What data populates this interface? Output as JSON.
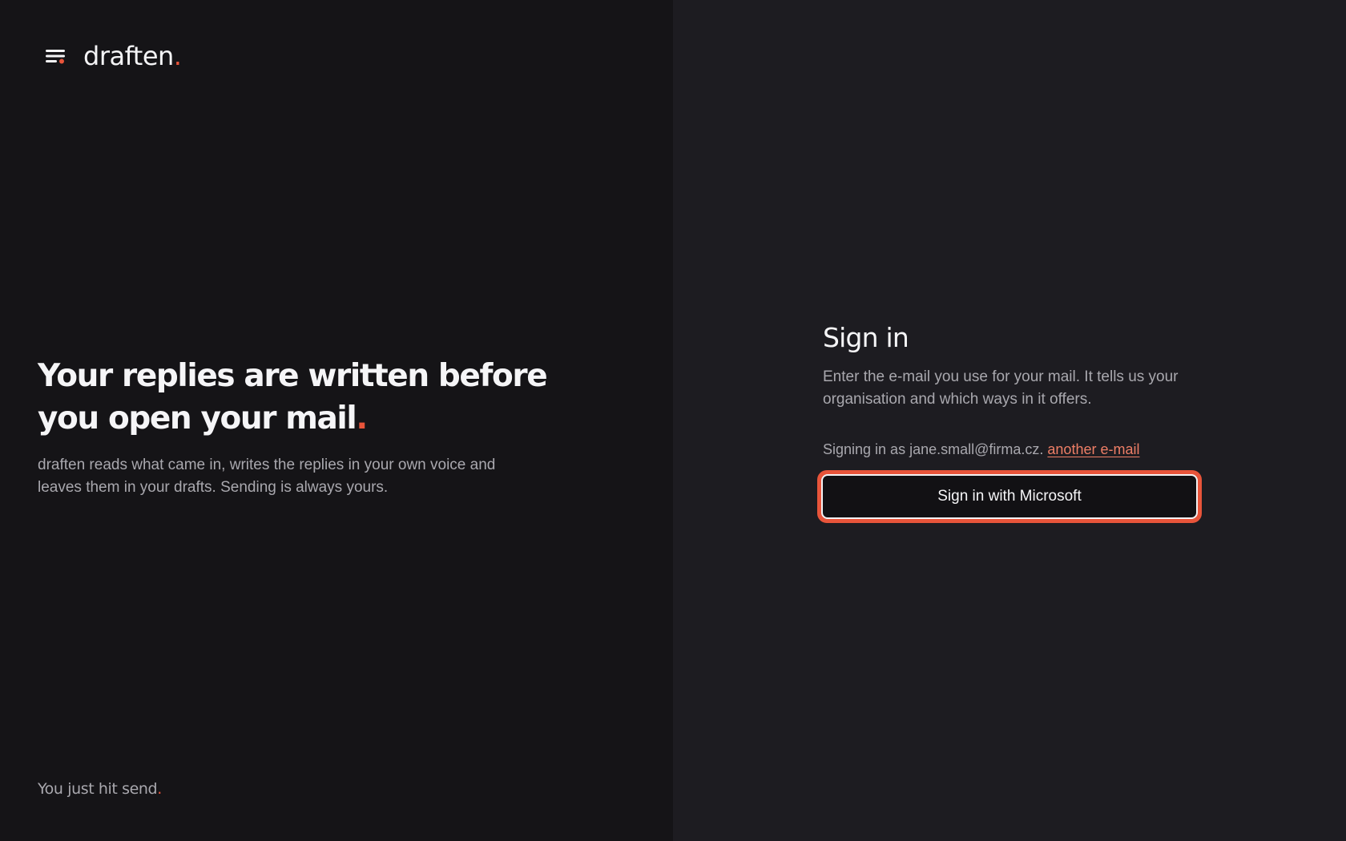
{
  "brand": {
    "name": "draften",
    "dot": "."
  },
  "hero": {
    "title_line1": "Your replies are written before",
    "title_line2": "you open your mail",
    "title_dot": ".",
    "subtitle": "draften reads what came in, writes the replies in your own voice and leaves them in your drafts. Sending is always yours."
  },
  "tagline": {
    "text": "You just hit send",
    "dot": "."
  },
  "signin": {
    "title": "Sign in",
    "description": "Enter the e-mail you use for your mail. It tells us your organisation and which ways in it offers.",
    "signing_as_prefix": "Signing in as jane.small@firma.cz.",
    "another_email_link": "another e-mail",
    "microsoft_button_label": "Sign in with Microsoft"
  },
  "colors": {
    "accent": "#e8543a",
    "left_background": "#151417",
    "right_background": "#1d1c21",
    "link": "#ee7e66"
  },
  "icons": {
    "menu": "menu-lines-icon"
  }
}
